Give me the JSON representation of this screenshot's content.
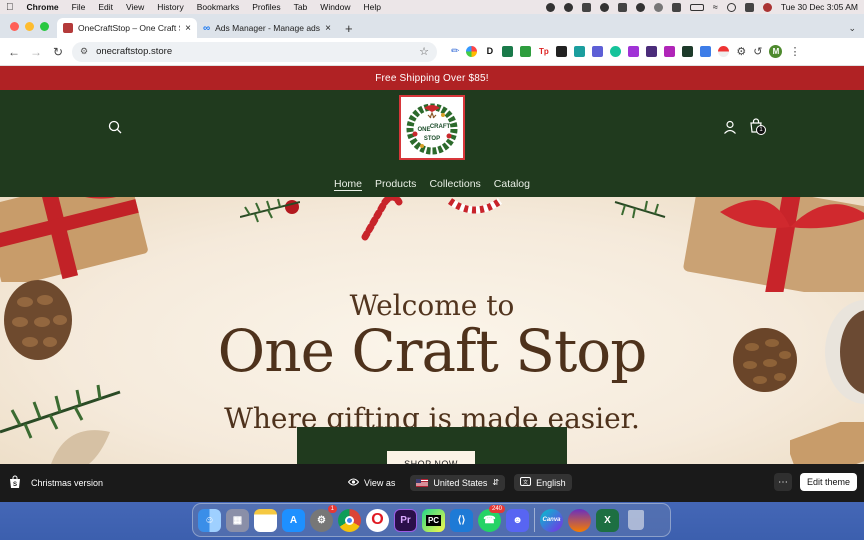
{
  "menubar": {
    "app": "Chrome",
    "items": [
      "File",
      "Edit",
      "View",
      "History",
      "Bookmarks",
      "Profiles",
      "Tab",
      "Window",
      "Help"
    ],
    "clock": "Tue 30 Dec  3:05 AM"
  },
  "tabs": [
    {
      "title": "OneCraftStop – One Craft St",
      "active": true
    },
    {
      "title": "Ads Manager - Manage ads -",
      "active": false
    }
  ],
  "address": {
    "url": "onecraftstop.store"
  },
  "announcement": "Free Shipping Over $85!",
  "store": {
    "logo_text": [
      "ONE",
      "CRAFT",
      "STOP"
    ],
    "cart_count": "1",
    "nav": [
      {
        "label": "Home",
        "current": true
      },
      {
        "label": "Products",
        "current": false
      },
      {
        "label": "Collections",
        "current": false
      },
      {
        "label": "Catalog",
        "current": false
      }
    ]
  },
  "hero": {
    "welcome": "Welcome to",
    "title": "One Craft Stop",
    "subtitle": "Where gifting is made easier.",
    "cta": "SHOP NOW"
  },
  "editor_bar": {
    "theme_name": "Christmas version",
    "view_as": "View as",
    "country": "United States",
    "language": "English",
    "edit_button": "Edit theme"
  },
  "dock": {
    "badges": {
      "settings": "1",
      "whatsapp": "240"
    },
    "apps": [
      "Finder",
      "Launchpad",
      "Notes",
      "App Store",
      "System Settings",
      "Chrome",
      "Opera",
      "Premiere Pro",
      "PyCharm",
      "VS Code",
      "WhatsApp",
      "Discord",
      "Canva",
      "Audio",
      "Excel",
      "Trash"
    ]
  },
  "colors": {
    "header_green": "#203a1e",
    "announcement_red": "#b02224",
    "hero_text_brown": "#4e321c"
  }
}
